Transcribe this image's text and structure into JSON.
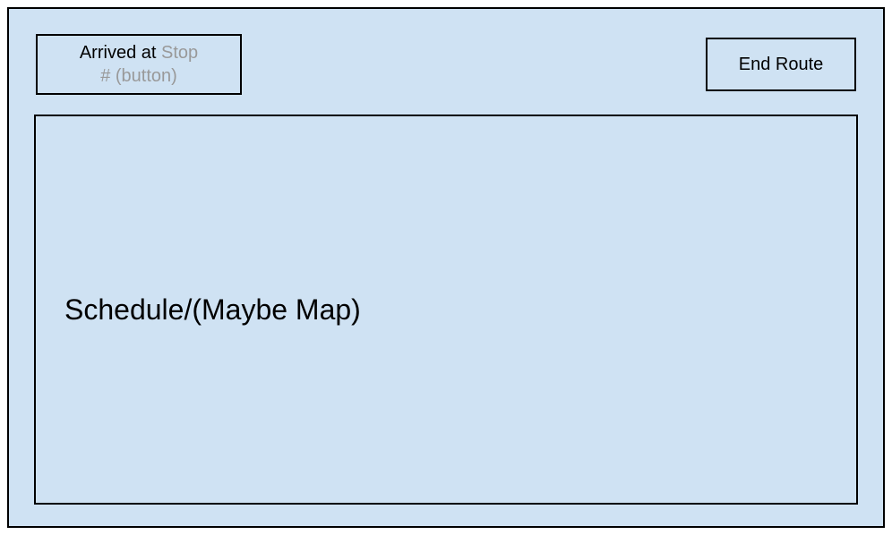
{
  "topbar": {
    "arrived": {
      "prefix": "Arrived at ",
      "placeholder_line1": "Stop",
      "placeholder_line2": "# (button)"
    },
    "end_route_label": "End Route"
  },
  "main": {
    "label": "Schedule/(Maybe Map)"
  }
}
